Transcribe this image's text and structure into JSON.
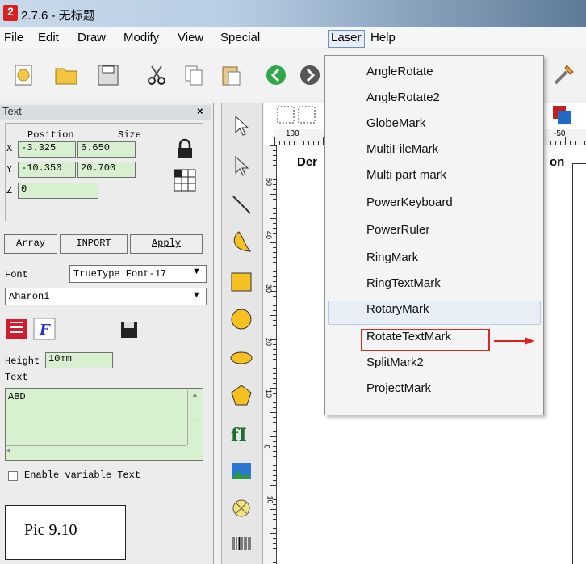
{
  "window": {
    "title": "2.7.6 - 无标题",
    "app_icon_label": "2"
  },
  "menubar": {
    "items": [
      "File",
      "Edit",
      "Draw",
      "Modify",
      "View",
      "Special",
      "Laser",
      "Help"
    ]
  },
  "toolbar": {
    "buttons": [
      "new-icon",
      "open-icon",
      "save-icon",
      "cut-icon",
      "copy-icon",
      "paste-icon",
      "back-icon",
      "forward-icon"
    ]
  },
  "text_panel": {
    "title": "Text",
    "close": "×",
    "position_label": "Position",
    "size_label": "Size",
    "x_label": "X",
    "y_label": "Y",
    "z_label": "Z",
    "x_pos": "-3.325",
    "x_size": "6.650",
    "y_pos": "-10.350",
    "y_size": "20.700",
    "z_val": "0",
    "array_btn": "Array",
    "import_btn": "INPORT",
    "apply_btn": "Apply",
    "font_label": "Font",
    "font_type": "TrueType Font-17",
    "font_name": "Aharoni",
    "height_label": "Height",
    "height_value": "10mm",
    "text_label": "Text",
    "text_value": "ABD",
    "enable_variable": "Enable variable Text"
  },
  "canvas": {
    "ruler_top": [
      "100",
      "-50"
    ],
    "ruler_left": [
      "50",
      "40",
      "30",
      "20",
      "10",
      "0",
      "-10"
    ],
    "text_fragment_left": "Der",
    "text_fragment_right": "on"
  },
  "laser_menu": {
    "items": [
      "AngleRotate",
      "AngleRotate2",
      "GlobeMark",
      "MultiFileMark",
      "Multi part mark",
      "PowerKeyboard",
      "PowerRuler",
      "RingMark",
      "RingTextMark",
      "RotaryMark",
      "RotateTextMark",
      "SplitMark2",
      "ProjectMark"
    ],
    "hovered": "RotaryMark",
    "highlighted": "RotateTextMark"
  },
  "caption": "Pic 9.10",
  "colors": {
    "field_bg": "#d7f0d0",
    "arrow": "#e02020",
    "highlight_border": "#d42b2b"
  }
}
